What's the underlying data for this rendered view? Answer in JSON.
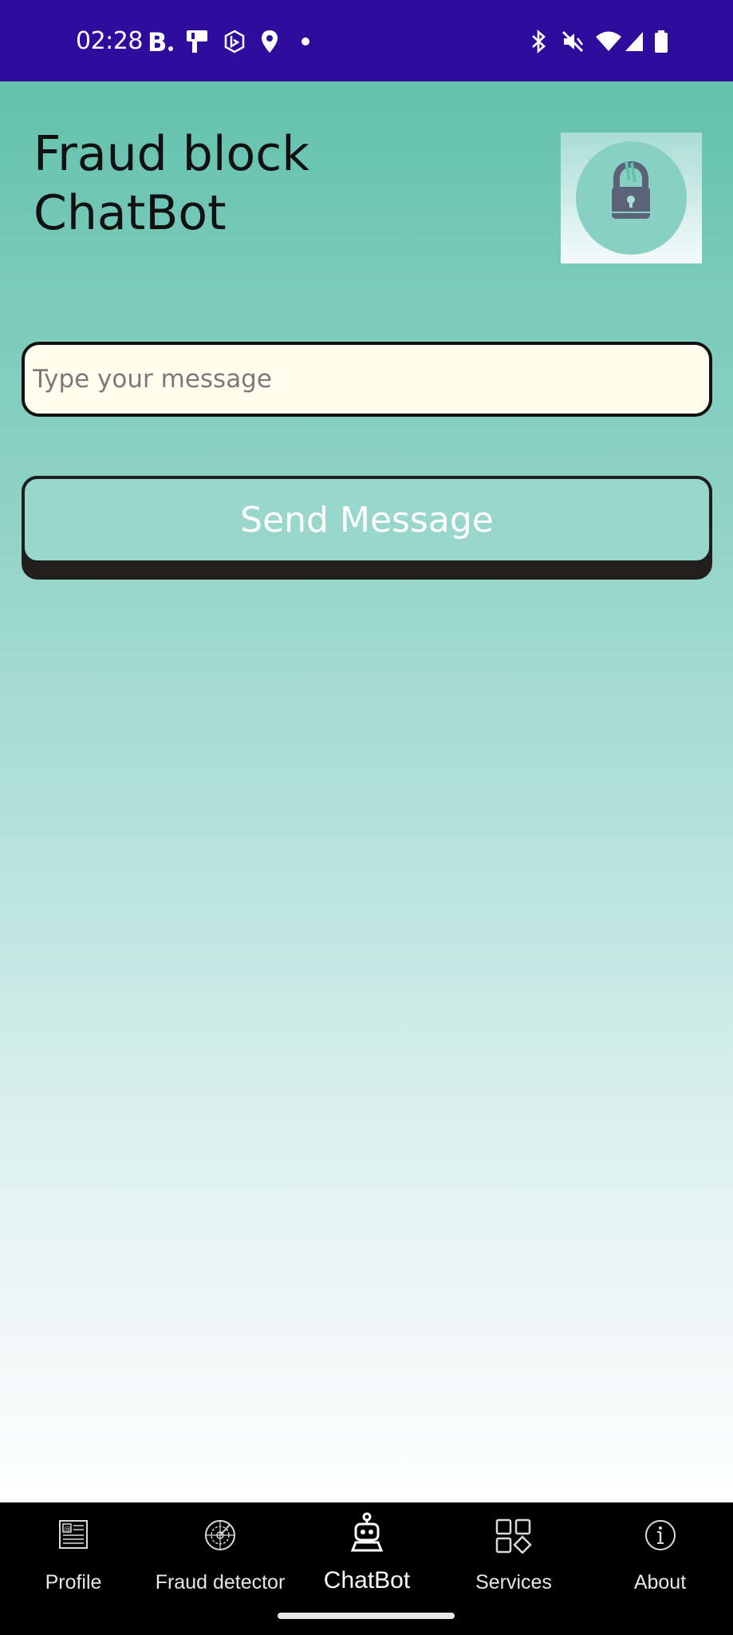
{
  "status_bar": {
    "time": "02:28",
    "left_icons": [
      "booking-b-icon",
      "parking-sign-icon",
      "bing-icon",
      "location-pin-icon",
      "notification-dot-icon"
    ],
    "right_icons": [
      "bluetooth-icon",
      "mute-icon",
      "wifi-icon",
      "cell-signal-icon",
      "battery-icon"
    ],
    "background_color": "#2e0c9c"
  },
  "header": {
    "title_line1": "Fraud block",
    "title_line2": "ChatBot",
    "logo_icon": "padlock-icon"
  },
  "chat": {
    "input_value": "",
    "input_placeholder": "Type your message",
    "send_label": "Send Message"
  },
  "bottom_nav": {
    "items": [
      {
        "label": "Profile",
        "icon": "id-card-icon"
      },
      {
        "label": "Fraud detector",
        "icon": "radar-icon"
      },
      {
        "label": "ChatBot",
        "icon": "robot-icon",
        "active": true
      },
      {
        "label": "Services",
        "icon": "grid-shapes-icon"
      },
      {
        "label": "About",
        "icon": "info-icon"
      }
    ]
  },
  "colors": {
    "gradient_top": "#64c1ae",
    "gradient_bottom": "#ffffff",
    "input_background": "#fffdee",
    "button_background": "#99d6cb",
    "nav_background": "#000000"
  }
}
